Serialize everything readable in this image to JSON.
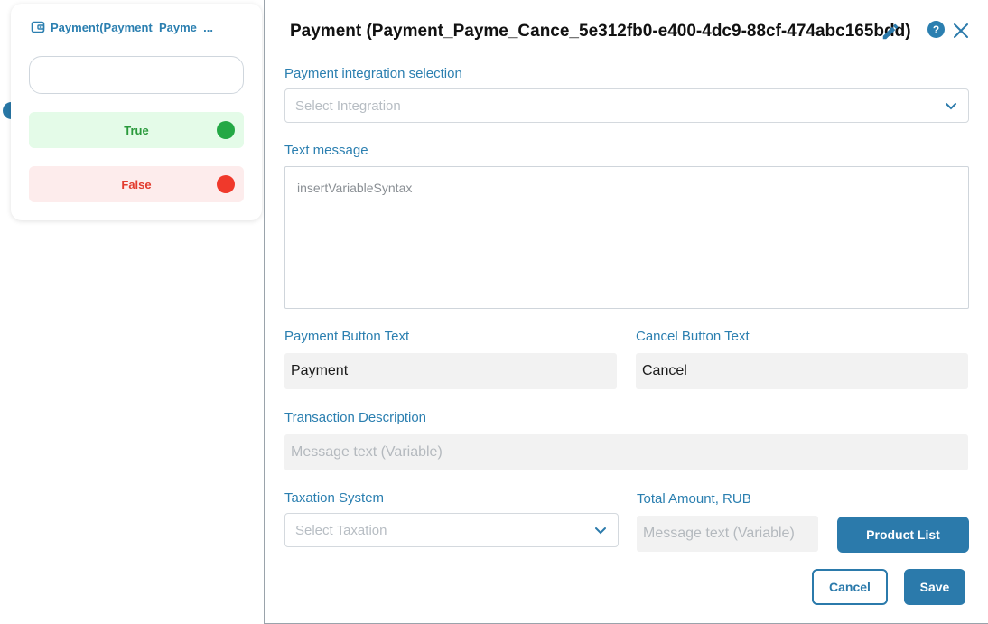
{
  "node": {
    "title": "Payment(Payment_Payme_...",
    "icon": "wallet-icon",
    "branches": {
      "true_label": "True",
      "false_label": "False"
    },
    "colors": {
      "true": "#24a845",
      "false": "#f0392b",
      "handle": "#2877a6"
    }
  },
  "modal": {
    "title": "Payment (Payment_Payme_Cance_5e312fb0-e400-4dc9-88cf-474abc165bdd)",
    "help_label": "?",
    "integration": {
      "label": "Payment integration selection",
      "placeholder": "Select Integration"
    },
    "text_message": {
      "label": "Text message",
      "value": "insertVariableSyntax"
    },
    "payment_button": {
      "label": "Payment Button Text",
      "value": "Payment"
    },
    "cancel_button_text": {
      "label": "Cancel Button Text",
      "value": "Cancel"
    },
    "transaction": {
      "label": "Transaction Description",
      "placeholder": "Message text (Variable)"
    },
    "taxation": {
      "label": "Taxation System",
      "placeholder": "Select Taxation"
    },
    "total_amount": {
      "label": "Total Amount, RUB",
      "placeholder": "Message text (Variable)"
    },
    "product_list_label": "Product List",
    "cancel_label": "Cancel",
    "save_label": "Save"
  },
  "colors": {
    "accent": "#2b7aab",
    "label": "#2b7fb0"
  }
}
